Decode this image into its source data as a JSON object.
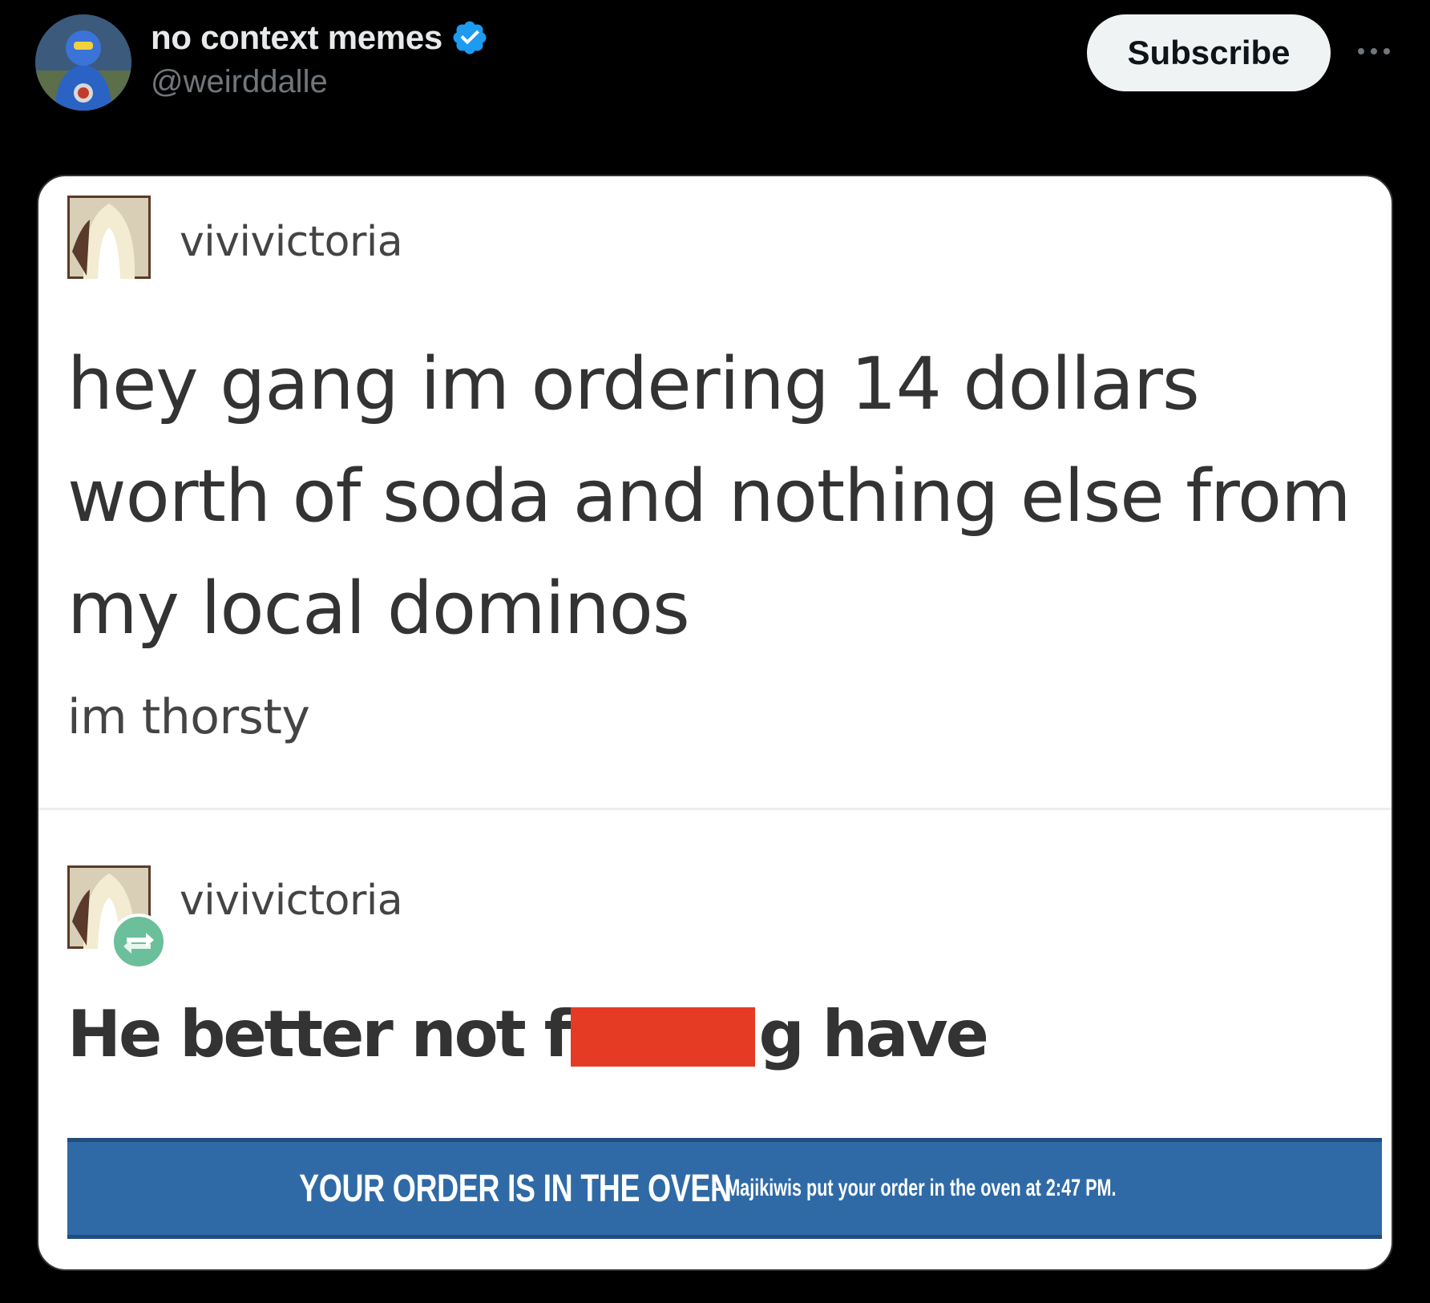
{
  "tweet": {
    "display_name": "no context memes",
    "handle": "@weirddalle",
    "subscribe_label": "Subscribe",
    "avatar_icon": "blue-superhero-avatar",
    "verified_icon": "verified-badge-icon",
    "more_icon": "more-options-icon"
  },
  "embedded_post": {
    "username": "vivivictoria",
    "main_text": "hey gang im ordering 14 dollars worth of soda and nothing else from my local dominos",
    "sub_text": "im thorsty"
  },
  "reblog_post": {
    "username": "vivivictoria",
    "text_before": "He better not f",
    "text_after": "g have",
    "reblog_icon": "reblog-icon",
    "censor_color": "#e53b25"
  },
  "order_banner": {
    "title": "YOUR ORDER IS IN THE OVEN",
    "detail": "- Majikiwis put your order in the oven at 2:47 PM.",
    "color": "#2f6aa6"
  },
  "colors": {
    "background": "#000000",
    "verified": "#1d9bf0",
    "subscribe_bg": "#eff3f4",
    "handle": "#71767b"
  }
}
